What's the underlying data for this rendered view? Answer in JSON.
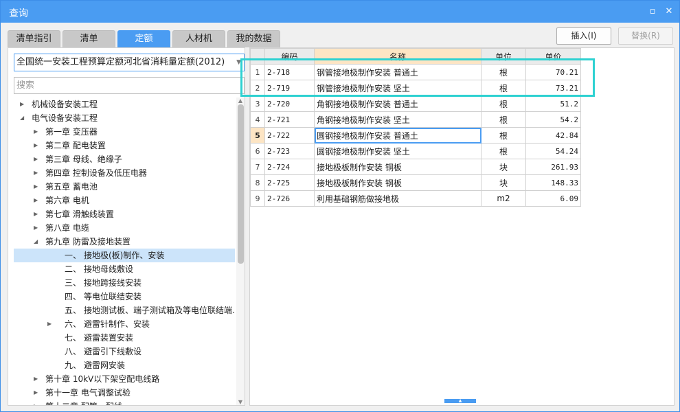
{
  "window": {
    "title": "查询"
  },
  "tabs": [
    {
      "label": "清单指引"
    },
    {
      "label": "清单"
    },
    {
      "label": "定额",
      "active": true
    },
    {
      "label": "人材机"
    },
    {
      "label": "我的数据"
    }
  ],
  "buttons": {
    "insert": "插入(I)",
    "replace": "替换(R)"
  },
  "left": {
    "quota_library": "全国统一安装工程预算定额河北省消耗量定额(2012)",
    "search_placeholder": "搜索"
  },
  "tree": [
    {
      "level": 0,
      "toggle": "collapsed",
      "label": "机械设备安装工程"
    },
    {
      "level": 0,
      "toggle": "expanded",
      "label": "电气设备安装工程"
    },
    {
      "level": 1,
      "toggle": "collapsed",
      "label": "第一章 变压器"
    },
    {
      "level": 1,
      "toggle": "collapsed",
      "label": "第二章 配电装置"
    },
    {
      "level": 1,
      "toggle": "collapsed",
      "label": "第三章 母线、绝缘子"
    },
    {
      "level": 1,
      "toggle": "collapsed",
      "label": "第四章 控制设备及低压电器"
    },
    {
      "level": 1,
      "toggle": "collapsed",
      "label": "第五章 蓄电池"
    },
    {
      "level": 1,
      "toggle": "collapsed",
      "label": "第六章 电机"
    },
    {
      "level": 1,
      "toggle": "collapsed",
      "label": "第七章 滑触线装置"
    },
    {
      "level": 1,
      "toggle": "collapsed",
      "label": "第八章 电缆"
    },
    {
      "level": 1,
      "toggle": "expanded",
      "label": "第九章 防雷及接地装置"
    },
    {
      "level": 2,
      "toggle": "none",
      "num": "一、",
      "label": "接地极(板)制作、安装",
      "selected": true
    },
    {
      "level": 2,
      "toggle": "none",
      "num": "二、",
      "label": "接地母线敷设"
    },
    {
      "level": 2,
      "toggle": "none",
      "num": "三、",
      "label": "接地跨接线安装"
    },
    {
      "level": 2,
      "toggle": "none",
      "num": "四、",
      "label": "等电位联结安装"
    },
    {
      "level": 2,
      "toggle": "none",
      "num": "五、",
      "label": "接地测试板、端子测试箱及等电位联结端..."
    },
    {
      "level": 2,
      "toggle": "collapsed",
      "num": "六、",
      "label": "避雷针制作、安装"
    },
    {
      "level": 2,
      "toggle": "none",
      "num": "七、",
      "label": "避雷装置安装"
    },
    {
      "level": 2,
      "toggle": "none",
      "num": "八、",
      "label": "避雷引下线敷设"
    },
    {
      "level": 2,
      "toggle": "none",
      "num": "九、",
      "label": "避雷网安装"
    },
    {
      "level": 1,
      "toggle": "collapsed",
      "label": "第十章 10kV以下架空配电线路"
    },
    {
      "level": 1,
      "toggle": "collapsed",
      "label": "第十一章 电气调整试验"
    },
    {
      "level": 1,
      "toggle": "collapsed",
      "label": "第十二章 配管、配线"
    }
  ],
  "grid": {
    "columns": [
      "",
      "编码",
      "名称",
      "单位",
      "单价"
    ],
    "current_row": 5,
    "rows": [
      [
        "1",
        "2-718",
        "钢管接地极制作安装 普通土",
        "根",
        "70.21"
      ],
      [
        "2",
        "2-719",
        "钢管接地极制作安装 坚土",
        "根",
        "73.21"
      ],
      [
        "3",
        "2-720",
        "角钢接地极制作安装 普通土",
        "根",
        "51.2"
      ],
      [
        "4",
        "2-721",
        "角钢接地极制作安装 坚土",
        "根",
        "54.2"
      ],
      [
        "5",
        "2-722",
        "圆钢接地极制作安装 普通土",
        "根",
        "42.84"
      ],
      [
        "6",
        "2-723",
        "圆钢接地极制作安装 坚土",
        "根",
        "54.24"
      ],
      [
        "7",
        "2-724",
        "接地极板制作安装 铜板",
        "块",
        "261.93"
      ],
      [
        "8",
        "2-725",
        "接地极板制作安装 钢板",
        "块",
        "148.33"
      ],
      [
        "9",
        "2-726",
        "利用基础钢筋做接地极",
        "m2",
        "6.09"
      ]
    ]
  },
  "colors": {
    "accent": "#4a9cf2",
    "highlight_box": "#2ed1d1",
    "header_highlight": "#fde5c4"
  }
}
